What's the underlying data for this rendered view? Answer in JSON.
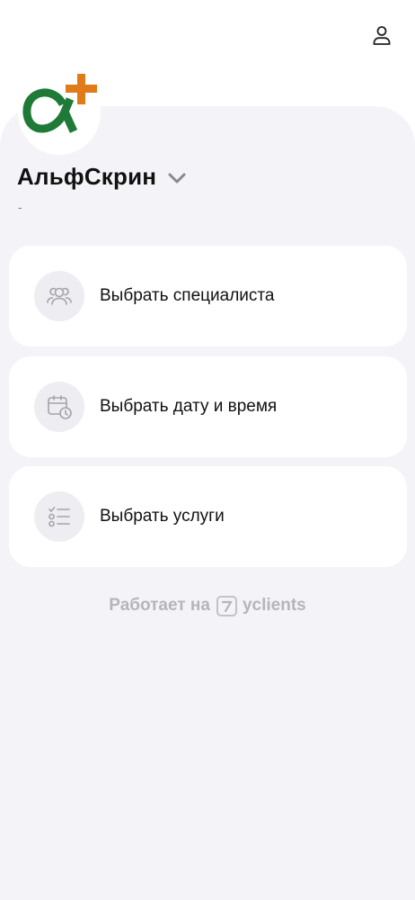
{
  "header": {
    "profile_icon": "user-icon"
  },
  "company": {
    "logo_icon": "alpha-plus-logo",
    "name": "АльфСкрин",
    "subtitle": "-",
    "colors": {
      "logo_green": "#1e7a36",
      "logo_orange": "#e07b1a"
    }
  },
  "actions": [
    {
      "label": "Выбрать специалиста",
      "icon": "people-icon"
    },
    {
      "label": "Выбрать дату и время",
      "icon": "calendar-clock-icon"
    },
    {
      "label": "Выбрать услуги",
      "icon": "checklist-icon"
    }
  ],
  "footer": {
    "powered_prefix": "Работает на",
    "brand": "yclients"
  }
}
